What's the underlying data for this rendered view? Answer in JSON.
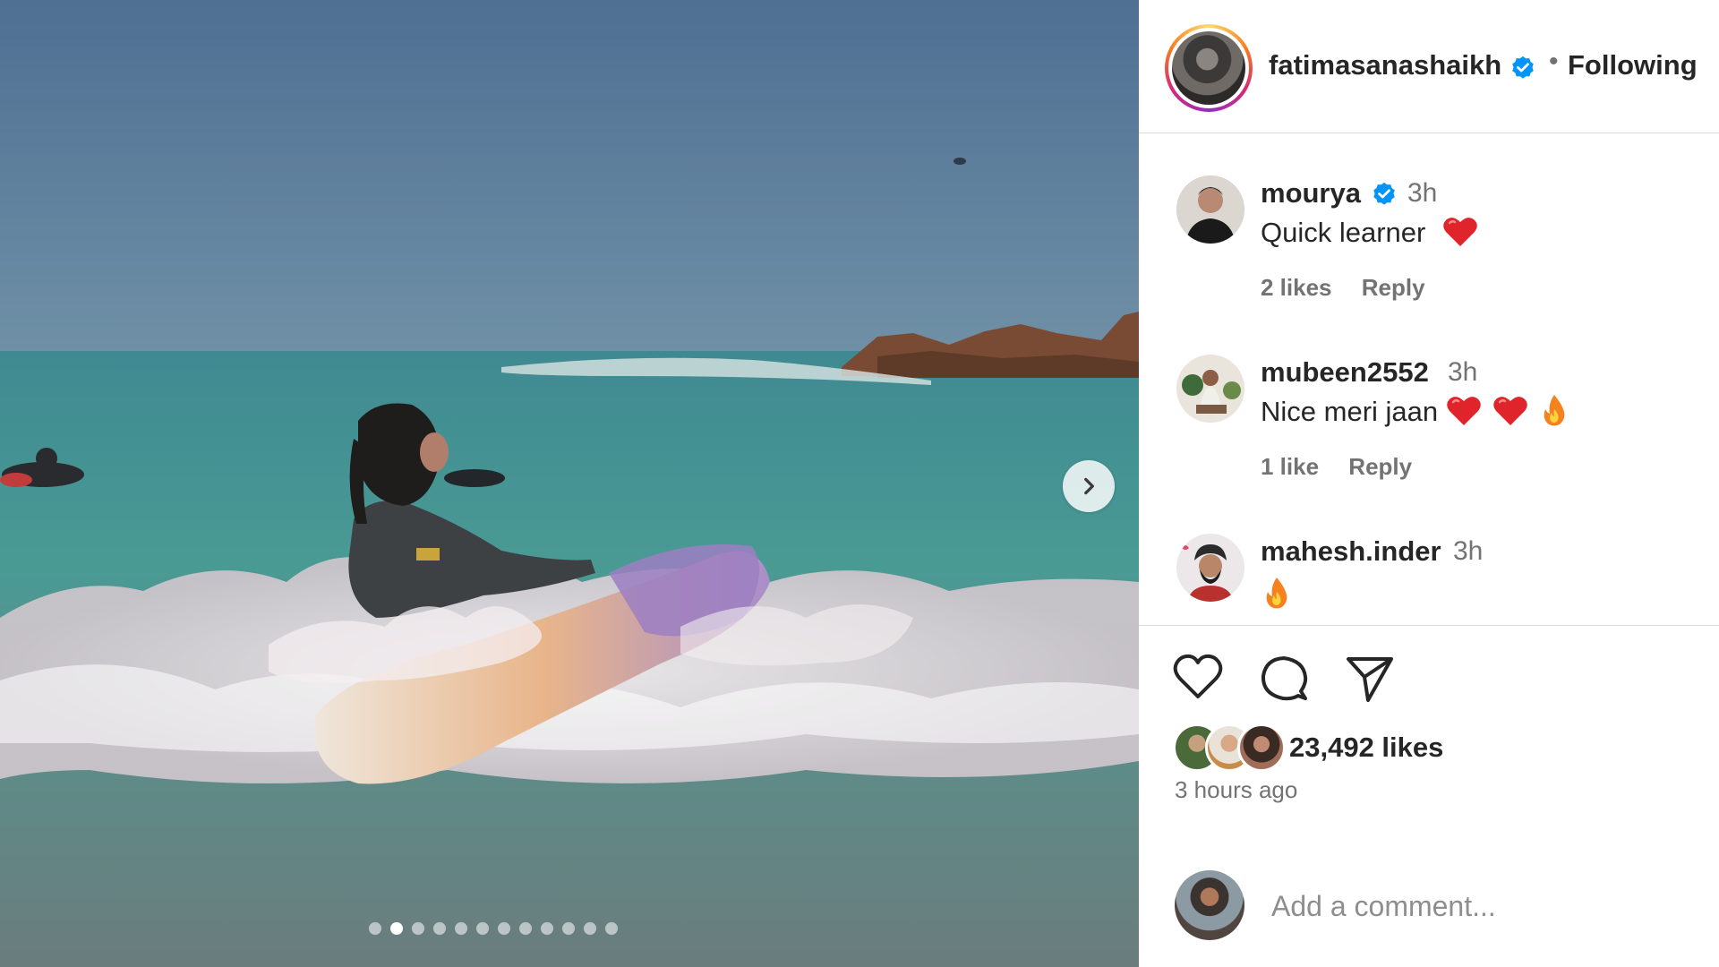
{
  "post": {
    "owner": {
      "username": "fatimasanashaikh",
      "verified": true,
      "separator": "•",
      "follow_status": "Following"
    },
    "carousel": {
      "total_slides": 12,
      "active_index": 1,
      "next_icon": "chevron-right-icon"
    },
    "comments": [
      {
        "username": "mourya",
        "verified": true,
        "time": "3h",
        "text": "Quick learner",
        "emojis": [
          "red-heart"
        ],
        "likes": "2 likes",
        "reply": "Reply"
      },
      {
        "username": "mubeen2552",
        "verified": false,
        "time": "3h",
        "text": "Nice meri jaan",
        "emojis": [
          "red-heart",
          "red-heart",
          "fire"
        ],
        "likes": "1 like",
        "reply": "Reply"
      },
      {
        "username": "mahesh.inder",
        "verified": false,
        "time": "3h",
        "text": "",
        "emojis": [
          "fire"
        ]
      }
    ],
    "actions": {
      "like_icon": "heart-icon",
      "comment_icon": "comment-icon",
      "share_icon": "paper-plane-icon"
    },
    "likes_count": "23,492 likes",
    "posted_ago": "3 hours ago",
    "add_comment": {
      "placeholder": "Add a comment..."
    },
    "colors": {
      "verified_blue": "#0095f6",
      "text": "#262626",
      "muted": "#737373",
      "divider": "#dbdbdb",
      "heart_red": "#e0242b"
    }
  }
}
